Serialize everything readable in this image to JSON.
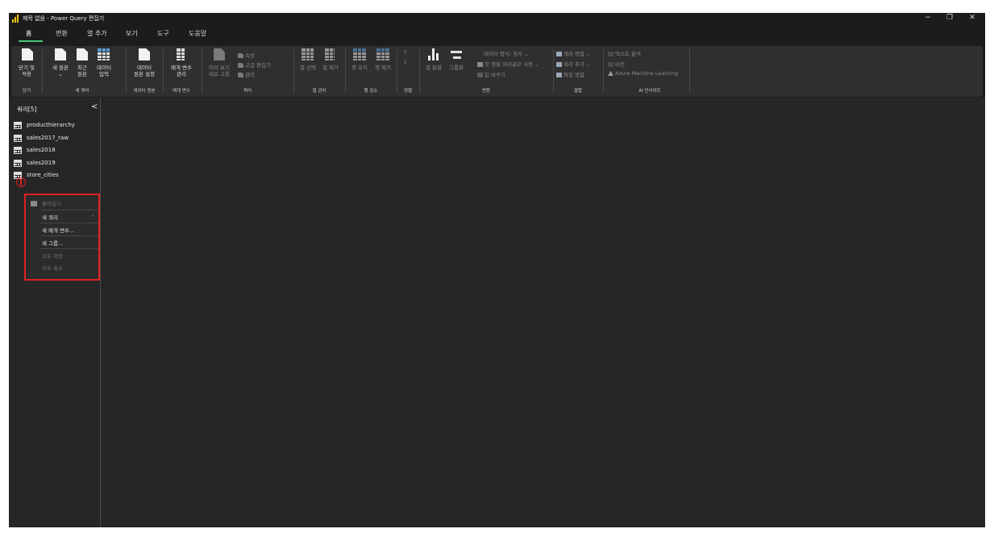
{
  "window": {
    "title": "제목 없음 - Power Query 편집기"
  },
  "window_controls": {
    "minimize": "−",
    "restore": "❐",
    "close": "✕"
  },
  "tabs": [
    {
      "label": "홈",
      "active": true
    },
    {
      "label": "변환"
    },
    {
      "label": "열 추가"
    },
    {
      "label": "보기"
    },
    {
      "label": "도구"
    },
    {
      "label": "도움말"
    }
  ],
  "ribbon": {
    "close": {
      "btn1": "닫기 및",
      "btn2": "적용",
      "group": "닫기"
    },
    "new_query": {
      "new_source_1": "새 원본",
      "recent_1": "최근",
      "recent_2": "원본",
      "enter_1": "데이터",
      "enter_2": "입력",
      "group": "새 쿼리"
    },
    "data_sources": {
      "btn1": "데이터",
      "btn2": "원본 설정",
      "group": "데이터 원본"
    },
    "parameters": {
      "btn1": "매개 변수",
      "btn2": "관리",
      "group": "매개 변수"
    },
    "query": {
      "refresh_1": "미리 보기",
      "refresh_2": "새로 고침",
      "properties": "속성",
      "advanced": "고급 편집기",
      "manage": "관리",
      "group": "쿼리"
    },
    "manage_columns": {
      "choose": "열 선택",
      "remove": "열 제거",
      "group": "열 관리"
    },
    "reduce_rows": {
      "keep": "행 유지",
      "remove": "행 제거",
      "group": "행 감소"
    },
    "sort": {
      "group": "정렬"
    },
    "transform": {
      "split": "열 분할",
      "group_by": "그룹화",
      "data_type": "데이터 형식: 정수",
      "first_row": "첫 행을 머리글로 사용",
      "replace": "값 바꾸기",
      "group": "변환"
    },
    "combine": {
      "merge": "쿼리 병합",
      "append": "쿼리 추가",
      "combine_files": "파일 병합",
      "group": "결합"
    },
    "ai": {
      "text": "텍스트 분석",
      "vision": "비전",
      "azure": "Azure Machine Learning",
      "group": "AI 인사이트"
    }
  },
  "queries_pane": {
    "title": "쿼리[5]",
    "collapse": "<",
    "items": [
      {
        "name": "producthierarchy"
      },
      {
        "name": "sales2017_raw"
      },
      {
        "name": "sales2018"
      },
      {
        "name": "sales2019"
      },
      {
        "name": "store_cities"
      }
    ]
  },
  "context_menu": {
    "paste": "붙여넣기",
    "new_query": "새 쿼리",
    "new_query_arrow": "›",
    "new_parameter": "새 매개 변수...",
    "new_group": "새 그룹...",
    "expand_all": "모두 확장",
    "collapse_all": "모두 축소"
  },
  "colors": {
    "accent": "#4ec27a",
    "highlight": "#e02020",
    "background": "#262626"
  }
}
